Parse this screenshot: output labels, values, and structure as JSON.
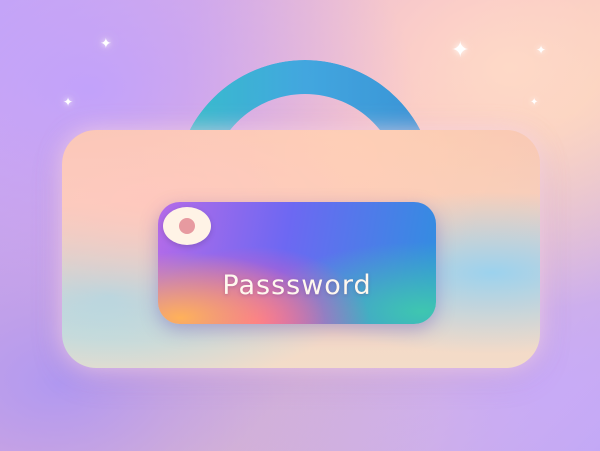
{
  "label": "Passsword",
  "icons": {
    "lock": "padlock-icon",
    "keyhole": "keyhole-icon",
    "sparkle": "sparkle-icon"
  },
  "colors": {
    "shackle": "#3aa6e0",
    "panel_start": "#b56be8",
    "panel_end": "#2f8fe0",
    "background": "#c9a8f2",
    "label_text": "#fff8ee"
  },
  "glyphs": {
    "sparkle": "✦"
  }
}
